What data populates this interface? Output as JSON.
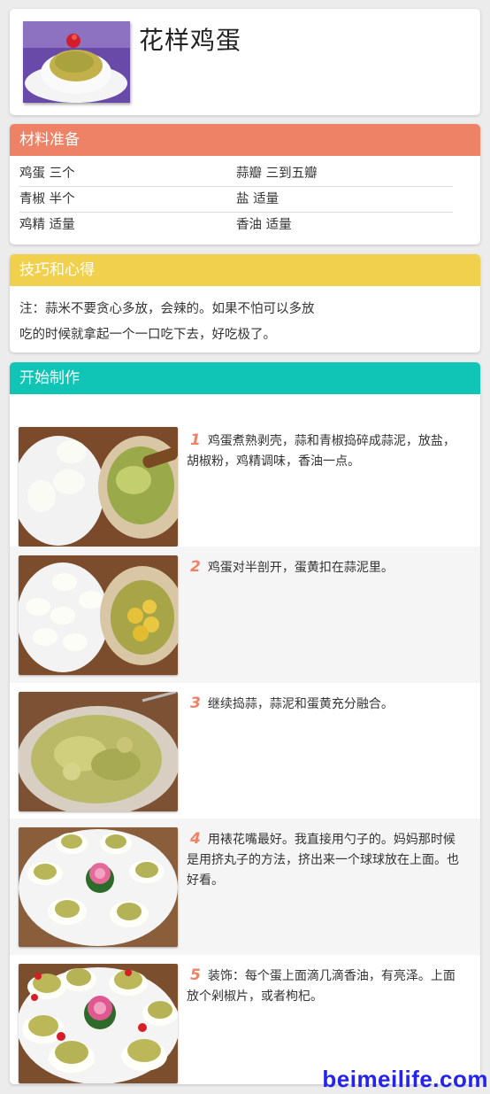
{
  "recipe": {
    "title": "花样鸡蛋"
  },
  "ingredients": {
    "header": "材料准备",
    "items": [
      {
        "left": "鸡蛋 三个",
        "right": "蒜瓣 三到五瓣"
      },
      {
        "left": "青椒 半个",
        "right": "盐 适量"
      },
      {
        "left": "鸡精 适量",
        "right": "香油 适量"
      }
    ]
  },
  "tips": {
    "header": "技巧和心得",
    "lines": [
      "注：蒜米不要贪心多放，会辣的。如果不怕可以多放",
      "吃的时候就拿起一个一口吃下去，好吃极了。"
    ]
  },
  "steps": {
    "header": "开始制作",
    "items": [
      {
        "num": "1",
        "text": "鸡蛋煮熟剥壳，蒜和青椒捣碎成蒜泥，放盐，胡椒粉，鸡精调味，香油一点。"
      },
      {
        "num": "2",
        "text": "鸡蛋对半剖开，蛋黄扣在蒜泥里。"
      },
      {
        "num": "3",
        "text": "继续捣蒜，蒜泥和蛋黄充分融合。"
      },
      {
        "num": "4",
        "text": "用裱花嘴最好。我直接用勺子的。妈妈那时候是用挤丸子的方法，挤出来一个球球放在上面。也好看。"
      },
      {
        "num": "5",
        "text": "装饰：每个蛋上面滴几滴香油，有亮泽。上面放个剁椒片，或者枸杞。"
      }
    ]
  },
  "watermark": "beimeilife.com",
  "colors": {
    "ingredients_header": "#ee8266",
    "tips_header": "#f0d04d",
    "steps_header": "#10c5b5",
    "step_number": "#ee8266",
    "watermark": "#2424ee"
  }
}
